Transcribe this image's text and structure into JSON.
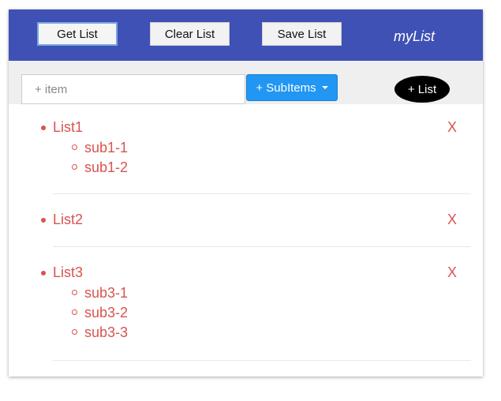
{
  "header": {
    "buttons": [
      "Get List",
      "Clear List",
      "Save List"
    ],
    "brand": "myList"
  },
  "toolbar": {
    "item_placeholder": "+ item",
    "subitems_label": "+ SubItems",
    "add_list_label": "+ List"
  },
  "lists": [
    {
      "title": "List1",
      "delete": "X",
      "items": [
        "sub1-1",
        "sub1-2"
      ]
    },
    {
      "title": "List2",
      "delete": "X",
      "items": []
    },
    {
      "title": "List3",
      "delete": "X",
      "items": [
        "sub3-1",
        "sub3-2",
        "sub3-3"
      ]
    }
  ],
  "colors": {
    "header_bg": "#3f51b5",
    "accent_blue": "#2196f3",
    "list_text": "#d9534f"
  }
}
